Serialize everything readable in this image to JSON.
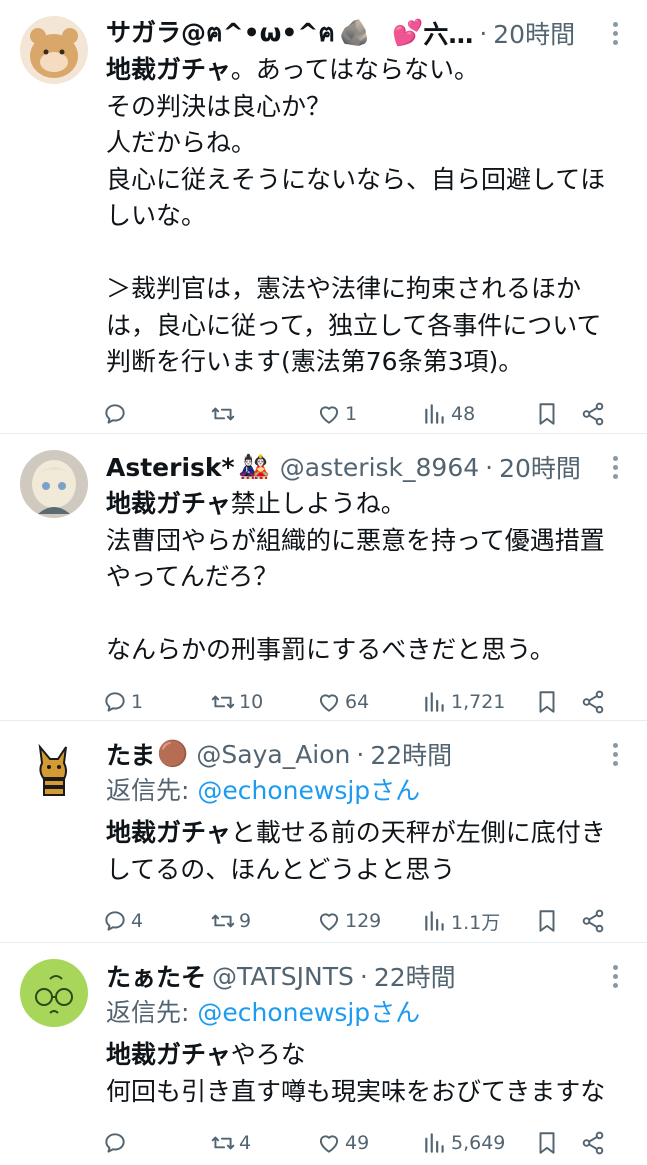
{
  "tweets": [
    {
      "name": "サガラ@ฅ^•ω•^ฅ",
      "emoji_a": "🪨",
      "emoji_b": "💕",
      "name_tail": "六…",
      "handle": "",
      "dot": "·",
      "time": "20時間",
      "reply_prefix": "",
      "reply_link": "",
      "lines": [
        {
          "bold": "地裁ガチャ",
          "text": "。あってはならない。"
        },
        {
          "bold": "",
          "text": "その判決は良心か？"
        },
        {
          "bold": "",
          "text": "人だからね。"
        },
        {
          "bold": "",
          "text": "良心に従えそうにないなら、自ら回避してほ"
        },
        {
          "bold": "",
          "text": "しいな。"
        },
        {
          "bold": "",
          "text": ""
        },
        {
          "bold": "",
          "text": "＞裁判官は，憲法や法律に拘束されるほか"
        },
        {
          "bold": "",
          "text": "は，良心に従って，独立して各事件について"
        },
        {
          "bold": "",
          "text": "判断を行います(憲法第76条第3項)。"
        }
      ],
      "replies": "",
      "retweets": "",
      "likes": "1",
      "views": "48"
    },
    {
      "name": "Asterisk*",
      "emoji_a": "🎎",
      "emoji_b": "",
      "name_tail": "",
      "handle": "@asterisk_8964",
      "dot": "·",
      "time": "20時間",
      "reply_prefix": "",
      "reply_link": "",
      "lines": [
        {
          "bold": "地裁ガチャ",
          "text": "禁止しようね。"
        },
        {
          "bold": "",
          "text": "法曹団やらが組織的に悪意を持って優遇措置"
        },
        {
          "bold": "",
          "text": "やってんだろ？"
        },
        {
          "bold": "",
          "text": ""
        },
        {
          "bold": "",
          "text": "なんらかの刑事罰にするべきだと思う。"
        }
      ],
      "replies": "1",
      "retweets": "10",
      "likes": "64",
      "views": "1,721"
    },
    {
      "name": "たま",
      "emoji_a": "🟤",
      "emoji_b": "",
      "name_tail": "",
      "handle": "@Saya_Aion",
      "dot": "·",
      "time": "22時間",
      "reply_prefix": "返信先: ",
      "reply_link": "@echonewsjpさん",
      "lines": [
        {
          "bold": "地裁ガチャ",
          "text": "と載せる前の天秤が左側に底付き"
        },
        {
          "bold": "",
          "text": "してるの、ほんとどうよと思う"
        }
      ],
      "replies": "4",
      "retweets": "9",
      "likes": "129",
      "views": "1.1万"
    },
    {
      "name": "たぁたそ",
      "emoji_a": "",
      "emoji_b": "",
      "name_tail": "",
      "handle": "@TATSJNTS",
      "dot": "·",
      "time": "22時間",
      "reply_prefix": "返信先: ",
      "reply_link": "@echonewsjpさん",
      "lines": [
        {
          "bold": "地裁ガチャ",
          "text": "やろな"
        },
        {
          "bold": "",
          "text": "何回も引き直す噂も現実味をおびてきますな"
        }
      ],
      "replies": "",
      "retweets": "4",
      "likes": "49",
      "views": "5,649"
    }
  ],
  "icons": [
    "reply-icon",
    "retweet-icon",
    "like-icon",
    "views-icon",
    "bookmark-icon",
    "share-icon",
    "more-icon"
  ],
  "colors": {
    "link": "#1d9bf0",
    "secondary": "#536471",
    "text": "#0f1419",
    "divider": "#e6ecf0"
  }
}
